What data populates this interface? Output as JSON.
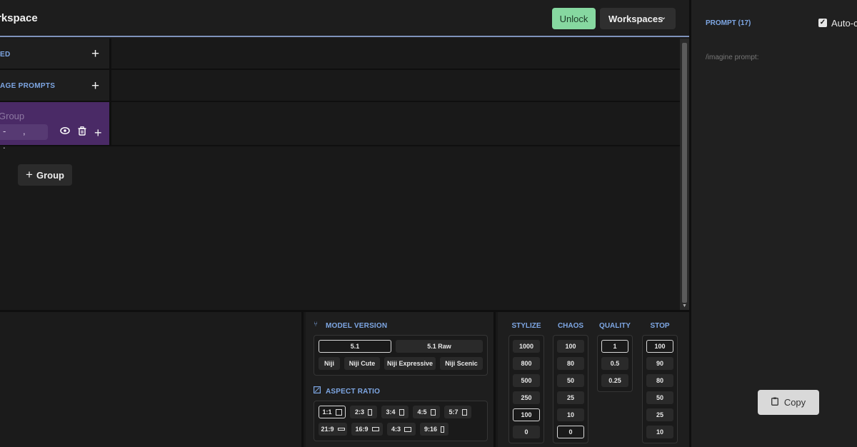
{
  "header": {
    "title": "rkspace",
    "unlock_label": "Unlock",
    "workspaces_label": "Workspaces"
  },
  "groups": {
    "rows": [
      {
        "label": "ED"
      },
      {
        "label": "AGE PROMPTS"
      }
    ],
    "active_group": {
      "name_placeholder": "Group",
      "input_value": "- , ."
    },
    "add_group_label": "Group"
  },
  "model": {
    "title": "MODEL VERSION",
    "versions": [
      "5.1",
      "5.1 Raw"
    ],
    "selected_version": "5.1",
    "niji": [
      "Niji",
      "Niji Cute",
      "Niji Expressive",
      "Niji Scenic"
    ]
  },
  "aspect": {
    "title": "ASPECT RATIO",
    "ratios": [
      "1:1",
      "2:3",
      "3:4",
      "4:5",
      "5:7",
      "21:9",
      "16:9",
      "4:3",
      "9:16"
    ],
    "selected": "1:1"
  },
  "params": {
    "stylize": {
      "title": "STYLIZE",
      "values": [
        "1000",
        "800",
        "500",
        "250",
        "100",
        "0"
      ],
      "selected": "100"
    },
    "chaos": {
      "title": "CHAOS",
      "values": [
        "100",
        "80",
        "50",
        "25",
        "10",
        "0"
      ],
      "selected": "0"
    },
    "quality": {
      "title": "QUALITY",
      "values": [
        "1",
        "0.5",
        "0.25"
      ],
      "selected": "1"
    },
    "stop": {
      "title": "STOP",
      "values": [
        "100",
        "90",
        "80",
        "50",
        "25",
        "10"
      ],
      "selected": "100"
    }
  },
  "prompt": {
    "title": "PROMPT (17)",
    "auto_label": "Auto-co",
    "text": "/imagine prompt:",
    "copy_label": "Copy"
  }
}
